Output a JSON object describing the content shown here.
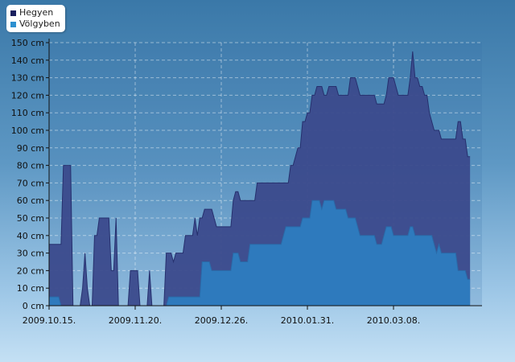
{
  "chart_data": {
    "type": "area",
    "title": "",
    "xlabel": "",
    "ylabel": "",
    "y_unit": "cm",
    "ylim": [
      0,
      150
    ],
    "y_ticks": [
      0,
      10,
      20,
      30,
      40,
      50,
      60,
      70,
      80,
      90,
      100,
      110,
      120,
      130,
      140,
      150
    ],
    "y_tick_labels": [
      "0 cm",
      "10 cm",
      "20 cm",
      "30 cm",
      "40 cm",
      "50 cm",
      "60 cm",
      "70 cm",
      "80 cm",
      "90 cm",
      "100 cm",
      "110 cm",
      "120 cm",
      "130 cm",
      "140 cm",
      "150 cm"
    ],
    "x_tick_labels": [
      "2009.10.15.",
      "2009.11.20.",
      "2009.12.26.",
      "2010.01.31.",
      "2010.03.08."
    ],
    "x_tick_dates": [
      "2009-10-15",
      "2009-11-20",
      "2009-12-26",
      "2010-01-31",
      "2010-03-08"
    ],
    "x_range": [
      "2009-10-15",
      "2010-04-14"
    ],
    "grid": true,
    "legend_position": "top-left",
    "series": [
      {
        "name": "Hegyen",
        "color": "#3b4a8c",
        "legend_color": "#1a1f5e",
        "points": [
          [
            "2009-10-15",
            35
          ],
          [
            "2009-10-20",
            35
          ],
          [
            "2009-10-21",
            80
          ],
          [
            "2009-10-24",
            80
          ],
          [
            "2009-10-25",
            0
          ],
          [
            "2009-10-28",
            0
          ],
          [
            "2009-10-29",
            10
          ],
          [
            "2009-10-30",
            30
          ],
          [
            "2009-10-31",
            10
          ],
          [
            "2009-11-01",
            0
          ],
          [
            "2009-11-02",
            0
          ],
          [
            "2009-11-03",
            40
          ],
          [
            "2009-11-04",
            40
          ],
          [
            "2009-11-05",
            50
          ],
          [
            "2009-11-09",
            50
          ],
          [
            "2009-11-10",
            20
          ],
          [
            "2009-11-11",
            20
          ],
          [
            "2009-11-12",
            50
          ],
          [
            "2009-11-13",
            0
          ],
          [
            "2009-11-17",
            0
          ],
          [
            "2009-11-18",
            20
          ],
          [
            "2009-11-21",
            20
          ],
          [
            "2009-11-22",
            0
          ],
          [
            "2009-11-25",
            0
          ],
          [
            "2009-11-26",
            20
          ],
          [
            "2009-11-27",
            0
          ],
          [
            "2009-12-02",
            0
          ],
          [
            "2009-12-03",
            30
          ],
          [
            "2009-12-05",
            30
          ],
          [
            "2009-12-06",
            25
          ],
          [
            "2009-12-07",
            30
          ],
          [
            "2009-12-10",
            30
          ],
          [
            "2009-12-11",
            40
          ],
          [
            "2009-12-14",
            40
          ],
          [
            "2009-12-15",
            50
          ],
          [
            "2009-12-16",
            40
          ],
          [
            "2009-12-17",
            50
          ],
          [
            "2009-12-18",
            50
          ],
          [
            "2009-12-19",
            55
          ],
          [
            "2009-12-22",
            55
          ],
          [
            "2009-12-23",
            50
          ],
          [
            "2009-12-24",
            45
          ],
          [
            "2009-12-30",
            45
          ],
          [
            "2009-12-31",
            60
          ],
          [
            "2010-01-01",
            65
          ],
          [
            "2010-01-02",
            65
          ],
          [
            "2010-01-03",
            60
          ],
          [
            "2010-01-09",
            60
          ],
          [
            "2010-01-10",
            70
          ],
          [
            "2010-01-23",
            70
          ],
          [
            "2010-01-24",
            80
          ],
          [
            "2010-01-25",
            80
          ],
          [
            "2010-01-26",
            85
          ],
          [
            "2010-01-27",
            90
          ],
          [
            "2010-01-28",
            90
          ],
          [
            "2010-01-29",
            105
          ],
          [
            "2010-01-30",
            105
          ],
          [
            "2010-01-31",
            110
          ],
          [
            "2010-02-01",
            110
          ],
          [
            "2010-02-02",
            120
          ],
          [
            "2010-02-03",
            120
          ],
          [
            "2010-02-04",
            125
          ],
          [
            "2010-02-06",
            125
          ],
          [
            "2010-02-07",
            120
          ],
          [
            "2010-02-08",
            120
          ],
          [
            "2010-02-09",
            125
          ],
          [
            "2010-02-12",
            125
          ],
          [
            "2010-02-13",
            120
          ],
          [
            "2010-02-17",
            120
          ],
          [
            "2010-02-18",
            130
          ],
          [
            "2010-02-20",
            130
          ],
          [
            "2010-02-21",
            125
          ],
          [
            "2010-02-22",
            120
          ],
          [
            "2010-02-28",
            120
          ],
          [
            "2010-03-01",
            115
          ],
          [
            "2010-03-04",
            115
          ],
          [
            "2010-03-05",
            120
          ],
          [
            "2010-03-06",
            130
          ],
          [
            "2010-03-08",
            130
          ],
          [
            "2010-03-09",
            125
          ],
          [
            "2010-03-10",
            120
          ],
          [
            "2010-03-14",
            120
          ],
          [
            "2010-03-15",
            130
          ],
          [
            "2010-03-16",
            145
          ],
          [
            "2010-03-17",
            130
          ],
          [
            "2010-03-18",
            130
          ],
          [
            "2010-03-19",
            125
          ],
          [
            "2010-03-20",
            125
          ],
          [
            "2010-03-21",
            120
          ],
          [
            "2010-03-22",
            120
          ],
          [
            "2010-03-23",
            110
          ],
          [
            "2010-03-24",
            105
          ],
          [
            "2010-03-25",
            100
          ],
          [
            "2010-03-27",
            100
          ],
          [
            "2010-03-28",
            95
          ],
          [
            "2010-04-03",
            95
          ],
          [
            "2010-04-04",
            105
          ],
          [
            "2010-04-05",
            105
          ],
          [
            "2010-04-06",
            95
          ],
          [
            "2010-04-07",
            95
          ],
          [
            "2010-04-08",
            85
          ],
          [
            "2010-04-09",
            85
          ]
        ]
      },
      {
        "name": "Völgyben",
        "color": "#2d7cc0",
        "legend_color": "#2d90d0",
        "points": [
          [
            "2009-10-15",
            5
          ],
          [
            "2009-10-19",
            5
          ],
          [
            "2009-10-20",
            0
          ],
          [
            "2009-12-03",
            0
          ],
          [
            "2009-12-04",
            5
          ],
          [
            "2009-12-17",
            5
          ],
          [
            "2009-12-18",
            25
          ],
          [
            "2009-12-21",
            25
          ],
          [
            "2009-12-22",
            20
          ],
          [
            "2009-12-30",
            20
          ],
          [
            "2009-12-31",
            30
          ],
          [
            "2010-01-02",
            30
          ],
          [
            "2010-01-03",
            25
          ],
          [
            "2010-01-06",
            25
          ],
          [
            "2010-01-07",
            35
          ],
          [
            "2010-01-20",
            35
          ],
          [
            "2010-01-21",
            40
          ],
          [
            "2010-01-22",
            45
          ],
          [
            "2010-01-28",
            45
          ],
          [
            "2010-01-29",
            50
          ],
          [
            "2010-02-01",
            50
          ],
          [
            "2010-02-02",
            60
          ],
          [
            "2010-02-05",
            60
          ],
          [
            "2010-02-06",
            55
          ],
          [
            "2010-02-07",
            60
          ],
          [
            "2010-02-11",
            60
          ],
          [
            "2010-02-12",
            55
          ],
          [
            "2010-02-16",
            55
          ],
          [
            "2010-02-17",
            50
          ],
          [
            "2010-02-20",
            50
          ],
          [
            "2010-02-21",
            45
          ],
          [
            "2010-02-22",
            40
          ],
          [
            "2010-02-28",
            40
          ],
          [
            "2010-02-29",
            35
          ],
          [
            "2010-03-03",
            35
          ],
          [
            "2010-03-04",
            40
          ],
          [
            "2010-03-05",
            45
          ],
          [
            "2010-03-07",
            45
          ],
          [
            "2010-03-08",
            40
          ],
          [
            "2010-03-14",
            40
          ],
          [
            "2010-03-15",
            45
          ],
          [
            "2010-03-16",
            45
          ],
          [
            "2010-03-17",
            40
          ],
          [
            "2010-03-24",
            40
          ],
          [
            "2010-03-25",
            35
          ],
          [
            "2010-03-26",
            30
          ],
          [
            "2010-03-27",
            35
          ],
          [
            "2010-03-28",
            30
          ],
          [
            "2010-04-03",
            30
          ],
          [
            "2010-04-04",
            20
          ],
          [
            "2010-04-07",
            20
          ],
          [
            "2010-04-08",
            15
          ],
          [
            "2010-04-09",
            15
          ]
        ]
      }
    ]
  }
}
